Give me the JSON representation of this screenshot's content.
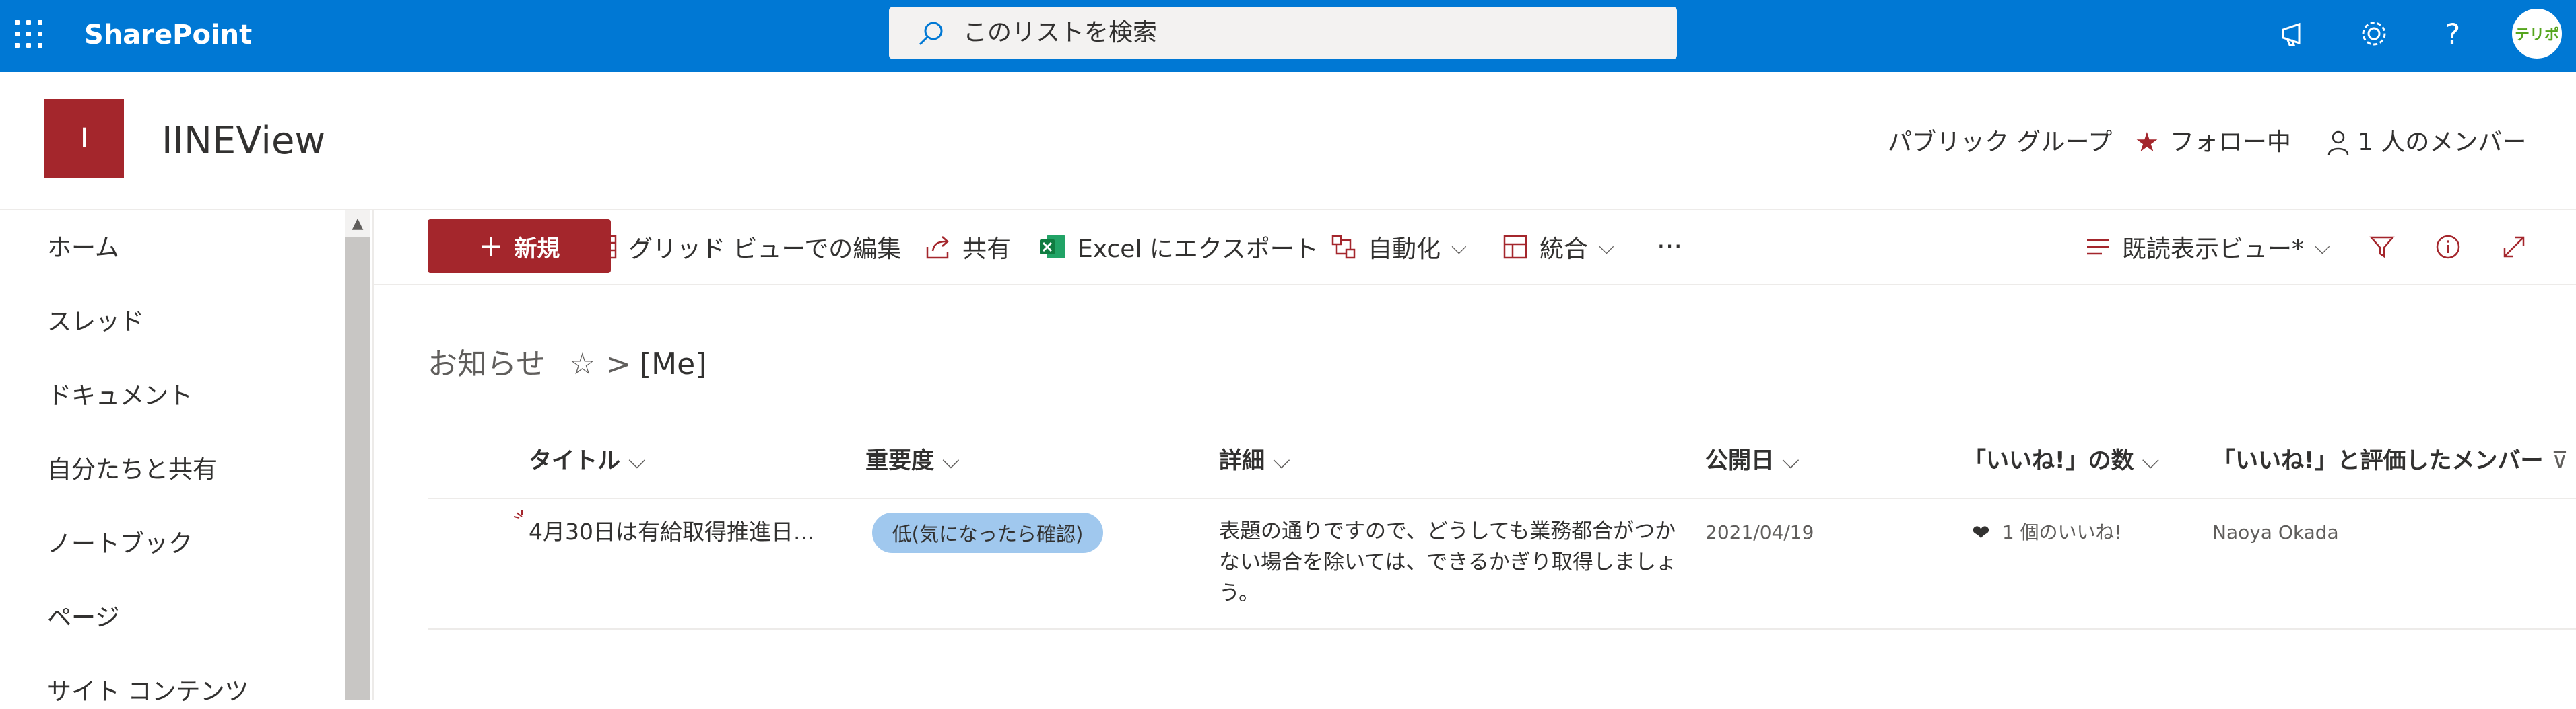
{
  "suite": {
    "brand": "SharePoint",
    "search_placeholder": "このリストを検索",
    "avatar_text": "テリポ"
  },
  "site": {
    "logo_letter": "I",
    "title": "IINEView",
    "group_type": "パブリック グループ",
    "follow_label": "フォロー中",
    "members_label": "1 人のメンバー"
  },
  "nav": {
    "items": [
      "ホーム",
      "スレッド",
      "ドキュメント",
      "自分たちと共有",
      "ノートブック",
      "ページ",
      "サイト コンテンツ"
    ]
  },
  "commands": {
    "new": "新規",
    "grid_edit": "グリッド ビューでの編集",
    "share": "共有",
    "export_excel": "Excel にエクスポート",
    "automate": "自動化",
    "integrate": "統合",
    "more": "···",
    "view_name": "既読表示ビュー*"
  },
  "breadcrumb": {
    "list": "お知らせ",
    "star": "☆",
    "separator": ">",
    "view": "[Me]"
  },
  "table": {
    "columns": [
      "タイトル",
      "重要度",
      "詳細",
      "公開日",
      "「いいね!」の数",
      "「いいね!」と評価したメンバー"
    ],
    "rows": [
      {
        "title": "4月30日は有給取得推進日...",
        "priority": "低(気になったら確認)",
        "detail_lines": [
          "表題の通りですので、どうしても業務都合がつか",
          "ない場合を除いては、できるかぎり取得しましょ",
          "う。"
        ],
        "date": "2021/04/19",
        "likes": "1 個のいいね!",
        "liked_by": "Naoya Okada"
      }
    ]
  },
  "colors": {
    "suite_blue": "#0078d4",
    "accent_red": "#a4262c",
    "badge_blue": "#a0c8ee"
  }
}
